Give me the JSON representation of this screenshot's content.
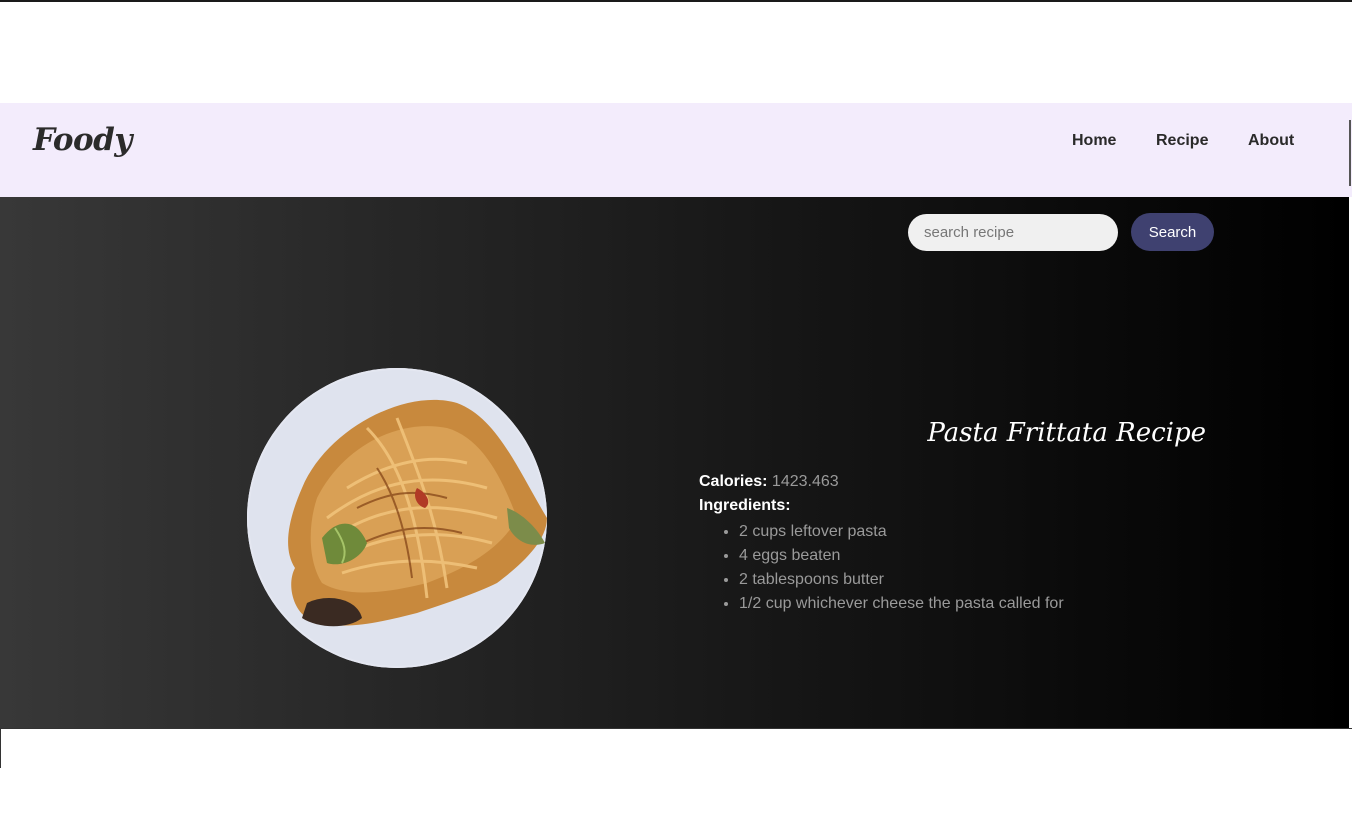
{
  "header": {
    "logo": "Foody",
    "nav": [
      {
        "label": "Home"
      },
      {
        "label": "Recipe"
      },
      {
        "label": "About"
      }
    ]
  },
  "search": {
    "placeholder": "search recipe",
    "button_label": "Search"
  },
  "recipe": {
    "title": "Pasta Frittata Recipe",
    "calories_label": "Calories:",
    "calories_value": "1423.463",
    "ingredients_label": "Ingredients:",
    "ingredients": [
      "2 cups leftover pasta",
      "4 eggs beaten",
      "2 tablespoons butter",
      "1/2 cup whichever cheese the pasta called for"
    ]
  },
  "colors": {
    "navbar_bg": "#f3ecfc",
    "search_button_bg": "#3f4170",
    "hero_gradient_start": "#383838",
    "hero_gradient_end": "#000000"
  }
}
